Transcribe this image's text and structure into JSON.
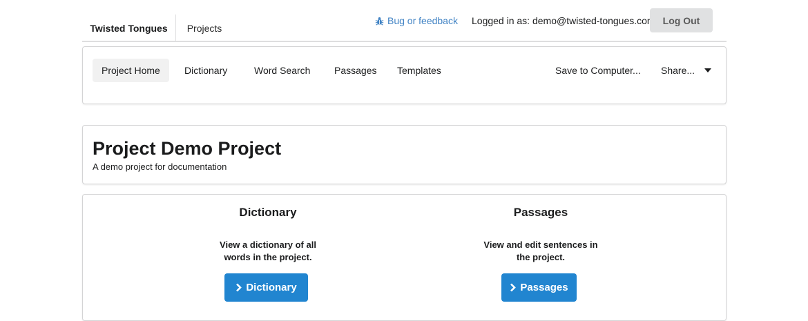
{
  "topbar": {
    "brand": "Twisted Tongues",
    "projects_label": "Projects",
    "bug_label": "Bug or feedback",
    "logged_in_text": "Logged in as: demo@twisted-tongues.com",
    "logout_label": "Log Out"
  },
  "menu": {
    "items": [
      {
        "label": "Project Home"
      },
      {
        "label": "Dictionary"
      },
      {
        "label": "Word Search"
      },
      {
        "label": "Passages"
      },
      {
        "label": "Templates"
      }
    ],
    "save_label": "Save to Computer...",
    "share_label": "Share..."
  },
  "project": {
    "title": "Project Demo Project",
    "description": "A demo project for documentation"
  },
  "sections": [
    {
      "heading": "Dictionary",
      "desc_line1": "View a dictionary of all",
      "desc_line2": "words in the project.",
      "button_label": "Dictionary"
    },
    {
      "heading": "Passages",
      "desc_line1": "View and edit sentences in",
      "desc_line2": "the project.",
      "button_label": "Passages"
    }
  ],
  "colors": {
    "primary": "#2185d0",
    "link": "#4183c4",
    "logout_bg": "#e0e1e2"
  }
}
